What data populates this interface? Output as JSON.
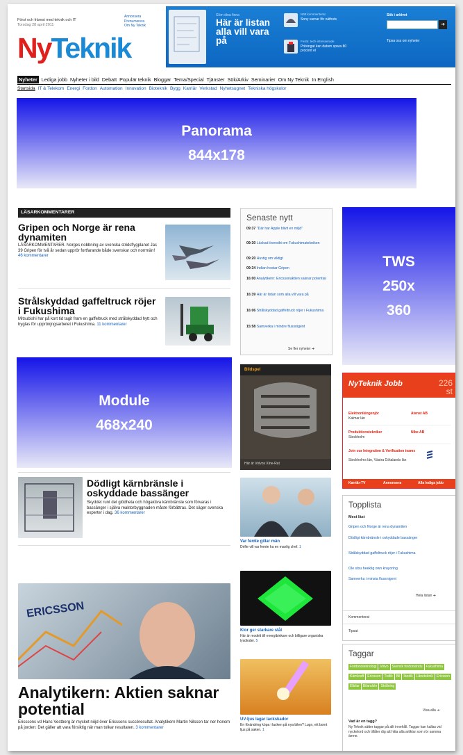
{
  "header": {
    "tagline": "Först och främst med teknik och IT",
    "date": "Torsdag 28 april 2011",
    "toplinks": [
      "Annonsera",
      "Prenumerera",
      "Om Ny Teknik"
    ],
    "logo_ny": "Ny",
    "logo_teknik": "Teknik",
    "banner": {
      "kicker": "Göm dina finna",
      "title": "Här är listan alla vill vara på",
      "news": [
        {
          "kicker": "Nätt kommenterat",
          "text": "Sony varnar för näthots"
        },
        {
          "kicker": "Festa: tech-intresserade",
          "text": "Prilsingat kan datum spara 80 procent el"
        }
      ]
    },
    "search": {
      "label": "Sök i arkivet",
      "button": "➜",
      "link": "Tipsa oss om nyheter"
    }
  },
  "nav": {
    "items": [
      "Nyheter",
      "Lediga jobb",
      "Nyheter i bild",
      "Debatt",
      "Populär teknik",
      "Bloggar",
      "Tema/Special",
      "Tjänster",
      "Sök/Arkiv",
      "Seminarier",
      "Om Ny Teknik",
      "In English"
    ],
    "active": "Nyheter",
    "sub": [
      "Startsida",
      "IT & Telekom",
      "Energi",
      "Fordon",
      "Automation",
      "Innovation",
      "Bioteknik",
      "Bygg",
      "Karriär",
      "Verkstad",
      "Nyhetsugnet",
      "Tekniska högskolor"
    ]
  },
  "ads": {
    "panorama": {
      "name": "Panorama",
      "size": "844x178"
    },
    "tws": {
      "name": "TWS",
      "size1": "250x",
      "size2": "360"
    },
    "module": {
      "name": "Module",
      "size": "468x240"
    }
  },
  "left": {
    "section": "LÄSARKOMMENTARER",
    "articles": [
      {
        "title": "Gripen och Norge är rena dynamiten",
        "body": "LÄSARKOMMENTARER. Norges nobbning av svenska stridsflygplanet Jas 39 Gripen för två år sedan upprör fortfarande både svenskar och norrmän!",
        "link": "46 kommentarer"
      },
      {
        "title": "Strålskyddad gaffeltruck röjer i Fukushima",
        "body": "Mitsubishi har på kort tid tagit fram en gaffeltruck med strålskyddad hytt och byglas för upprönjngsarbetet i Fukushima.",
        "link": "11 kommentarer"
      },
      {
        "title": "Dödligt kärnbränsle i oskyddade bassänger",
        "body": "Skyddet runt det glödheta och högaktiva kärnbränsle som förvaras i bassänger i själva reaktorbyggnaden måste förbättras. Det säger svenska experter i dag.",
        "link": "36 kommentarer"
      },
      {
        "title": "Analytikern: Aktien saknar potential",
        "body": "Ericssons vd Hans Vestberg är mycket nöjd över Ericssons succéresultat. Analytikern Martin Nilsson tar ner honom på jorden: Det gäller att vara försiktig när man tolkar resultaten.",
        "link": "3 kommentarer"
      }
    ],
    "photo_caption": "ERICSSON"
  },
  "middle": {
    "senaste_title": "Senaste nytt",
    "senaste": [
      {
        "time": "09:37",
        "text": "\"Där har Apple blivit en miljö\""
      },
      {
        "time": "09:30",
        "text": "Läckad översikt om Fukushimatekniken"
      },
      {
        "time": "09:20",
        "text": "Huvtig om viktigt"
      },
      {
        "time": "09:34",
        "text": "Indian hostar Gripen"
      },
      {
        "time": "16:00",
        "text": "Analytikern: Ericssonaktien saknar potential"
      },
      {
        "time": "16:39",
        "text": "Här är listan som alla vill vara på"
      },
      {
        "time": "16:06",
        "text": "Strålskyddad gaffeltruck röjer i Fukushima"
      },
      {
        "time": "15:58",
        "text": "Samverka i mindre flussnigent"
      }
    ],
    "senaste_more": "Se fler nyheter ➜",
    "bildspel_label": "Bildspel",
    "bildspel_caption": "Här är Volvos Xlne-Rat",
    "stories": [
      {
        "title": "Var femte gillar män",
        "body": "Drifte vill var femte ha en manlig chef.",
        "link": "1"
      },
      {
        "title": "Klor ger starkare stål",
        "body": "Här är modelt till energibinkare och billigare organiska lysdioder.",
        "link": "5"
      },
      {
        "title": "UV-ljus lagar lackskador",
        "body": "En förändring köpa i lacken på nya bilen? Lugn, ett bornt ljus på saken.",
        "link": "1"
      }
    ]
  },
  "right": {
    "jobb": {
      "title": "NyTeknik Jobb",
      "count": "226 st",
      "jobs": [
        {
          "title": "Elektronikingenjör",
          "place": "Kalmar län",
          "company": "Atenst AB"
        },
        {
          "title": "Produktionstekniker",
          "place": "Stockholm",
          "company": "Nibe AB"
        },
        {
          "title": "Join our Integration & Verification teams",
          "place": "Stockholms län, Västra Götalands län",
          "company": ""
        }
      ],
      "footer": [
        "Karriär-TV",
        "Annonsera",
        "Alla lediga jobb"
      ]
    },
    "topplista": {
      "title": "Topplista",
      "subtitle": "Mest läst",
      "items": [
        "Gripen och Norge är rena dynamiten",
        "Dödligt kärnbränsle i oskyddade bassänger",
        "Strålskyddad gaffeltruck röjer i Fukushima",
        "Ole stou heeklig own krayoring",
        "Samverka i minsta flussnigent"
      ],
      "more": "Hela listan ➜",
      "rows": [
        "Kommenterat",
        "Tipsat"
      ]
    },
    "taggar": {
      "title": "Taggar",
      "tags": [
        "Fordonsteknologi",
        "Volvo",
        "Svensk fordonsindu",
        "Fukushima",
        "Kärnkraft",
        "Ericsson",
        "Trafik",
        "Bil",
        "Ibodik",
        "Låneteknik",
        "Ericsson",
        "Elbilar",
        "Bilaralskr",
        "Strålning"
      ],
      "more": "Visa alla ➜",
      "q": "Vad är en tagg?",
      "q_body": "Ny Teknik sätter taggar på allt innehåll. Taggar kan kallas vid nyckelord och tillåter dig att hitta alla artiklar som rör samma ämne."
    }
  },
  "colors": {
    "brand_blue": "#1a8ad6",
    "brand_red": "#e0201c",
    "jobb_orange": "#e8401c",
    "tag_green": "#8ec63f",
    "link": "#1560b8"
  }
}
